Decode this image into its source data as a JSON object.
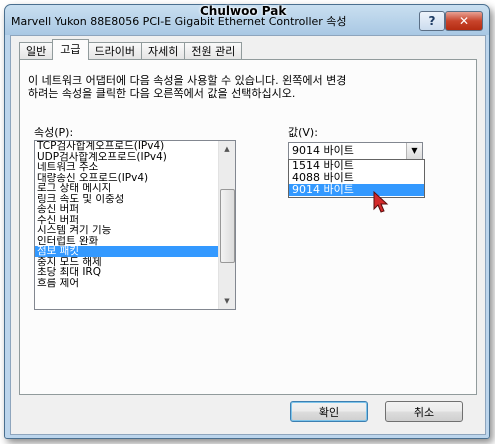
{
  "window": {
    "title": "Marvell Yukon 88E8056 PCI-E Gigabit Ethernet Controller 속성",
    "watermark": "Chulwoo Pak",
    "help_label": "?",
    "close_label": "✕"
  },
  "tabs": [
    {
      "label": "일반"
    },
    {
      "label": "고급"
    },
    {
      "label": "드라이버"
    },
    {
      "label": "자세히"
    },
    {
      "label": "전원 관리"
    }
  ],
  "active_tab": "고급",
  "panel": {
    "description": "이 네트워크 어댑터에 다음 속성을 사용할 수 있습니다. 왼쪽에서 변경\n하려는 속성을 클릭한 다음 오른쪽에서 값을 선택하십시오.",
    "properties_label": "속성(P):",
    "value_label": "값(V):"
  },
  "properties": [
    {
      "label": "TCP검사합계오프로드(IPv4)"
    },
    {
      "label": "UDP검사합계오프로드(IPv4)"
    },
    {
      "label": "네트워크 주소"
    },
    {
      "label": "대량송신 오프로드(IPv4)"
    },
    {
      "label": "로그 상태 메시지"
    },
    {
      "label": "링크 속도 및 이중성"
    },
    {
      "label": "송신 버퍼"
    },
    {
      "label": "수신 버퍼"
    },
    {
      "label": "시스템 켜기 기능"
    },
    {
      "label": "인터럽트 완화"
    },
    {
      "label": "점보 패킷"
    },
    {
      "label": "중지 모드 해제"
    },
    {
      "label": "초당 최대 IRQ"
    },
    {
      "label": "흐름 제어"
    }
  ],
  "selected_property": "점보 패킷",
  "value": {
    "selected": "9014 바이트",
    "options": [
      {
        "label": "1514 바이트"
      },
      {
        "label": "4088 바이트"
      },
      {
        "label": "9014 바이트"
      }
    ]
  },
  "buttons": {
    "ok": "확인",
    "cancel": "취소"
  },
  "icons": {
    "scroll_up": "▲",
    "scroll_down": "▼",
    "dropdown_arrow": "▼"
  },
  "colors": {
    "selection": "#3399ff",
    "close_button": "#c8442b"
  }
}
